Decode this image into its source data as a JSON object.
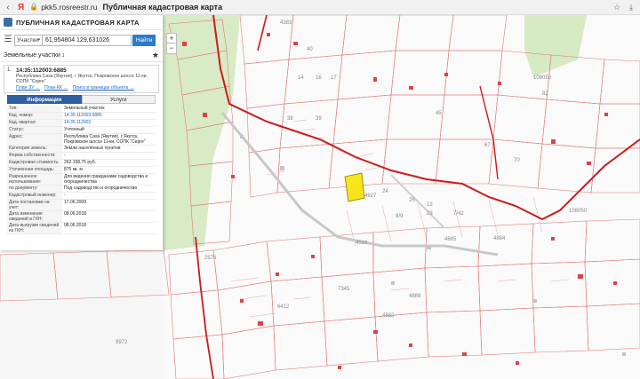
{
  "browser": {
    "url": "pkk5.rosreestr.ru",
    "title": "Публичная кадастровая карта",
    "ya_logo": "Я"
  },
  "panel": {
    "title": "ПУБЛИЧНАЯ КАДАСТРОВАЯ КАРТА",
    "search_type": "Участки",
    "search_value": "61,954804 129,631026",
    "search_button": "Найти",
    "section_title": "Земельные участки",
    "section_count": "1",
    "card": {
      "num": "1.",
      "cad_number": "14:35:112003:6885",
      "address": "Республика Саха (Якутия), г Якутск, Покровское шоссе 11-ки, СОПК \"Серге\"",
      "links": [
        "План ЗУ →",
        "План КК →",
        "Поиск в границах объекта →"
      ]
    },
    "tabs": {
      "info": "Информация",
      "services": "Услуги"
    },
    "props": [
      {
        "k": "Тип:",
        "v": "Земельный участок",
        "link": false
      },
      {
        "k": "Кад. номер:",
        "v": "14:35:112003:6885",
        "link": true
      },
      {
        "k": "Кад. квартал:",
        "v": "14:35:112003",
        "link": true
      },
      {
        "k": "Статус:",
        "v": "Учтенный",
        "link": false
      },
      {
        "k": "Адрес:",
        "v": "Республика Саха (Якутия), г Якутск, Покровское шоссе 11-ки, СОПК \"Серге\"",
        "link": false
      },
      {
        "k": "Категория земель:",
        "v": "Земли населённых пунктов",
        "link": false
      },
      {
        "k": "Форма собственности:",
        "v": "-",
        "link": false
      },
      {
        "k": "Кадастровая стоимость:",
        "v": "262 158,75 руб.",
        "link": false
      },
      {
        "k": "Уточненная площадь:",
        "v": "875 кв. м",
        "link": false
      },
      {
        "k": "Разрешенное использование:",
        "v": "Для ведения гражданами садоводства и огородничества",
        "link": false
      },
      {
        "k": "по документу:",
        "v": "Под садоводство и огородничество",
        "link": false
      },
      {
        "k": "Кадастровый инженер:",
        "v": "-",
        "link": false
      },
      {
        "k": "Дата постановки на учет:",
        "v": "17.06.2009",
        "link": false
      },
      {
        "k": "Дата изменения сведений в ГКН:",
        "v": "08.06.2018",
        "link": false
      },
      {
        "k": "Дата выгрузки сведений из ГКН:",
        "v": "08.06.2018",
        "link": false
      }
    ]
  },
  "map": {
    "labels": [
      "4383",
      "14",
      "16",
      "17",
      "40",
      "38",
      "39",
      "45",
      "67",
      "70",
      "82",
      "4884",
      "4885",
      "108050",
      "108050",
      "7/42",
      "23",
      "8/9",
      "25",
      "24",
      "4516",
      "12",
      "4882",
      "9972",
      "7345",
      "2576",
      "6412",
      "4889",
      "4927"
    ],
    "zoom_in": "+",
    "zoom_out": "−"
  }
}
